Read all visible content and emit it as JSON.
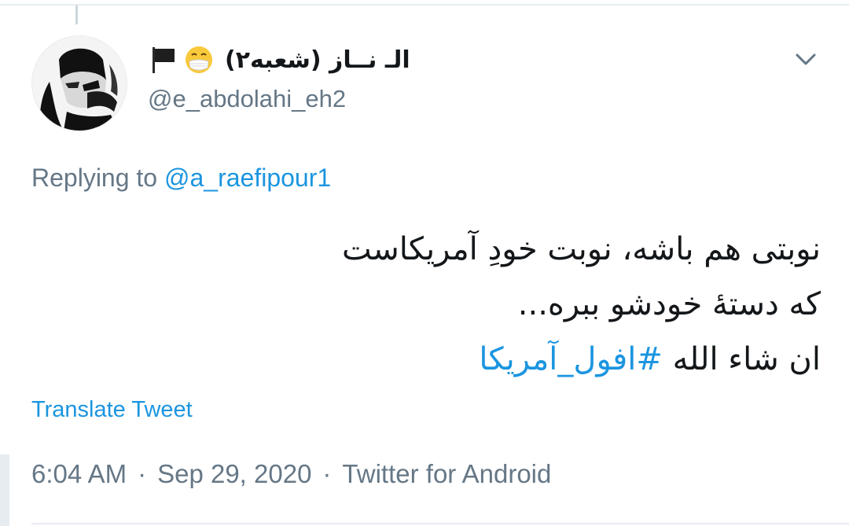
{
  "tweet": {
    "author": {
      "display_name": "الـ نــاز (شعبه۲)",
      "handle": "@e_abdolahi_eh2",
      "badges": [
        "face-with-medical-mask-icon",
        "black-flag-icon"
      ]
    },
    "replying_prefix": "Replying to ",
    "replying_to": "@a_raefipour1",
    "body_lines": [
      "نوبتی هم باشه، نوبت خودِ آمریکاست",
      "که دستهٔ خودشو ببره...",
      "ان شاء الله "
    ],
    "hashtag": "#افول_آمریکا",
    "translate_label": "Translate Tweet",
    "time": "6:04 AM",
    "date": "Sep 29, 2020",
    "separator": "·",
    "source": "Twitter for Android"
  },
  "colors": {
    "link": "#1b95e0",
    "secondary_text": "#657786",
    "primary_text": "#14171a",
    "border": "#e6ecf0"
  }
}
